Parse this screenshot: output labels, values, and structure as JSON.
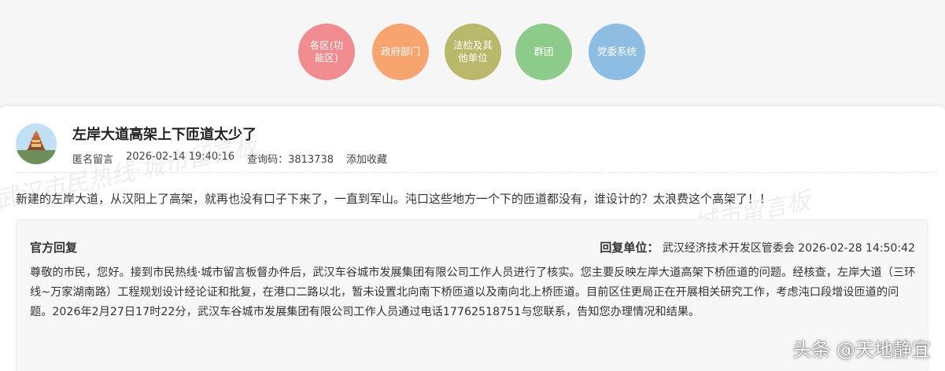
{
  "categories": [
    "各区(功能区)",
    "政府部门",
    "法检及其他单位",
    "群团",
    "党委系统"
  ],
  "post": {
    "title": "左岸大道高架上下匝道太少了",
    "author": "匿名留言",
    "datetime": "2026-02-14 19:40:16",
    "query_code": "查询码：3813738",
    "favorite": "添加收藏",
    "content": "新建的左岸大道，从汉阳上了高架，就再也没有口子下来了，一直到军山。沌口这些地方一个下的匝道都没有，谁设计的？太浪费这个高架了！！"
  },
  "reply": {
    "label": "官方回复",
    "unit_label": "回复单位：",
    "unit_name": "武汉经济技术开发区管委会",
    "datetime": "2026-02-28 14:50:42",
    "text": "尊敬的市民，您好。接到市民热线·城市留言板督办件后，武汉车谷城市发展集团有限公司工作人员进行了核实。您主要反映左岸大道高架下桥匝道的问题。经核查，左岸大道（三环线~万家湖南路）工程规划设计经论证和批复，在港口二路以北，暂未设置北向南下桥匝道以及南向北上桥匝道。目前区住更局正在开展相关研究工作，考虑沌口段增设匝道的问题。2026年2月27日17时22分，武汉车谷城市发展集团有限公司工作人员通过电话17762518751与您联系，告知您办理情况和结果。"
  },
  "watermarks": [
    "武汉市民热线·城市留言板",
    "城市留言板"
  ],
  "corner_watermark": "头条 @天地静宜",
  "colors": {
    "cat1": "#f08b8f",
    "cat2": "#f7a46e",
    "cat3": "#b9b86a",
    "cat4": "#8ccb8a",
    "cat5": "#8dbde2"
  }
}
